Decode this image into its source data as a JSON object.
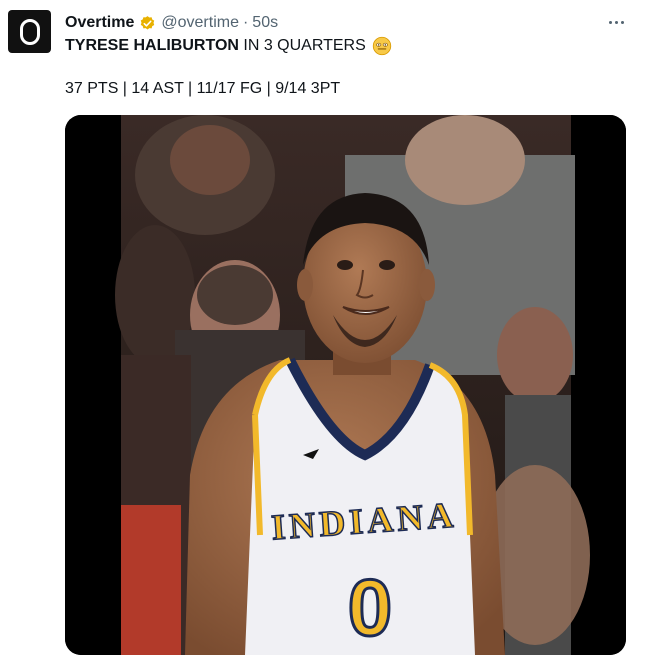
{
  "tweet": {
    "author_name": "Overtime",
    "verified_icon": "verified-badge-icon",
    "handle": "@overtime",
    "separator": "·",
    "time": "50s",
    "more_icon": "more-icon",
    "text_bold": "TYRESE HALIBURTON",
    "text_rest": " IN 3 QUARTERS",
    "emoji_icon": "smiling-face-emoji-icon",
    "stats_line": "37 PTS | 14 AST | 11/17 FG | 9/14 3PT"
  },
  "media": {
    "jersey_word": "INDIANA",
    "jersey_number": "0"
  },
  "colors": {
    "text": "#0f1419",
    "secondary": "#536471",
    "badge": "#e8b100",
    "jersey_navy": "#1d2b55",
    "jersey_gold": "#f2b92b"
  }
}
